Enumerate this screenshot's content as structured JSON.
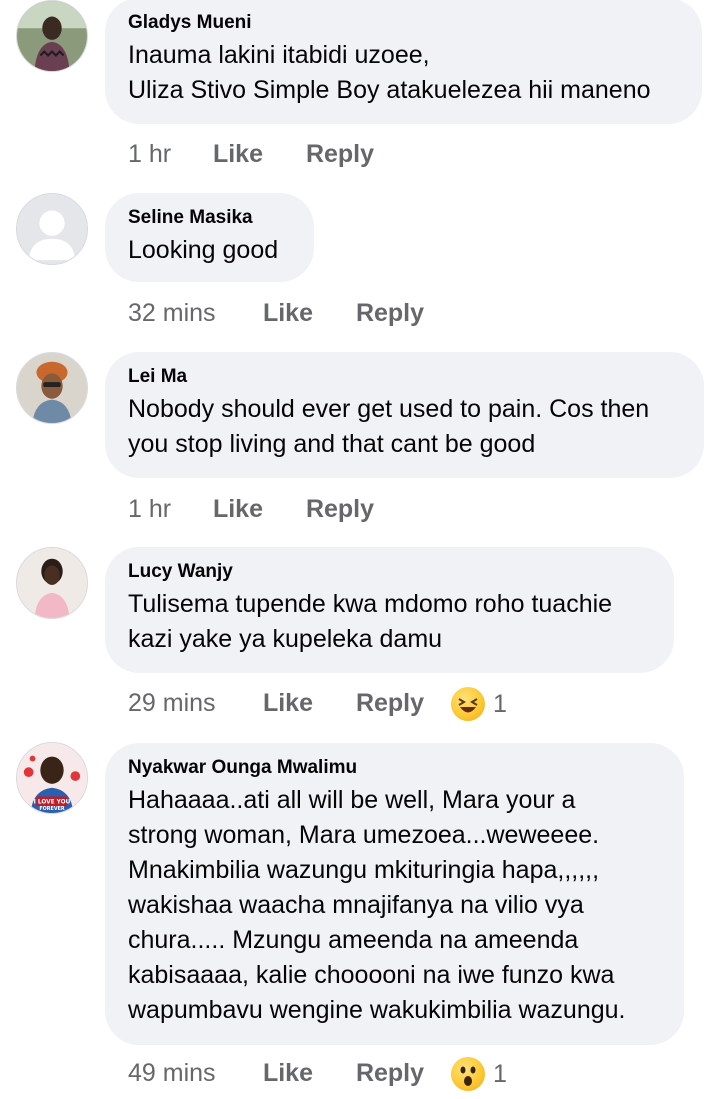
{
  "comments": [
    {
      "author": "Gladys Mueni",
      "text": "Inauma lakini itabidi uzoee,\nUliza Stivo Simple Boy atakuelezea hii maneno",
      "time": "1 hr",
      "like": "Like",
      "reply": "Reply"
    },
    {
      "author": "Seline Masika",
      "text": "Looking good",
      "time": "32 mins",
      "like": "Like",
      "reply": "Reply"
    },
    {
      "author": "Lei Ma",
      "text": "Nobody should ever get used to pain. Cos then\nyou stop living and that cant be good",
      "time": "1 hr",
      "like": "Like",
      "reply": "Reply"
    },
    {
      "author": "Lucy Wanjy",
      "text": "Tulisema tupende kwa mdomo roho tuachie\nkazi yake ya kupeleka damu",
      "time": "29 mins",
      "like": "Like",
      "reply": "Reply",
      "reaction_icon": "laughing-emoji-icon",
      "reaction_count": "1"
    },
    {
      "author": "Nyakwar Ounga Mwalimu",
      "text": "Hahaaaa..ati all will be well, Mara your a\nstrong woman, Mara umezoea...weweeee.\nMnakimbilia wazungu mkituringia hapa,,,,,,\nwakishaa waacha mnajifanya na vilio vya\nchura..... Mzungu ameenda na ameenda\nkabisaaaa, kalie chooooni na iwe funzo kwa\nwapumbavu wengine wakukimbilia wazungu.",
      "time": "49 mins",
      "like": "Like",
      "reply": "Reply",
      "reaction_icon": "wow-emoji-icon",
      "reaction_count": "1",
      "avatar_text": "I LOVE YOU FOREVER"
    }
  ]
}
